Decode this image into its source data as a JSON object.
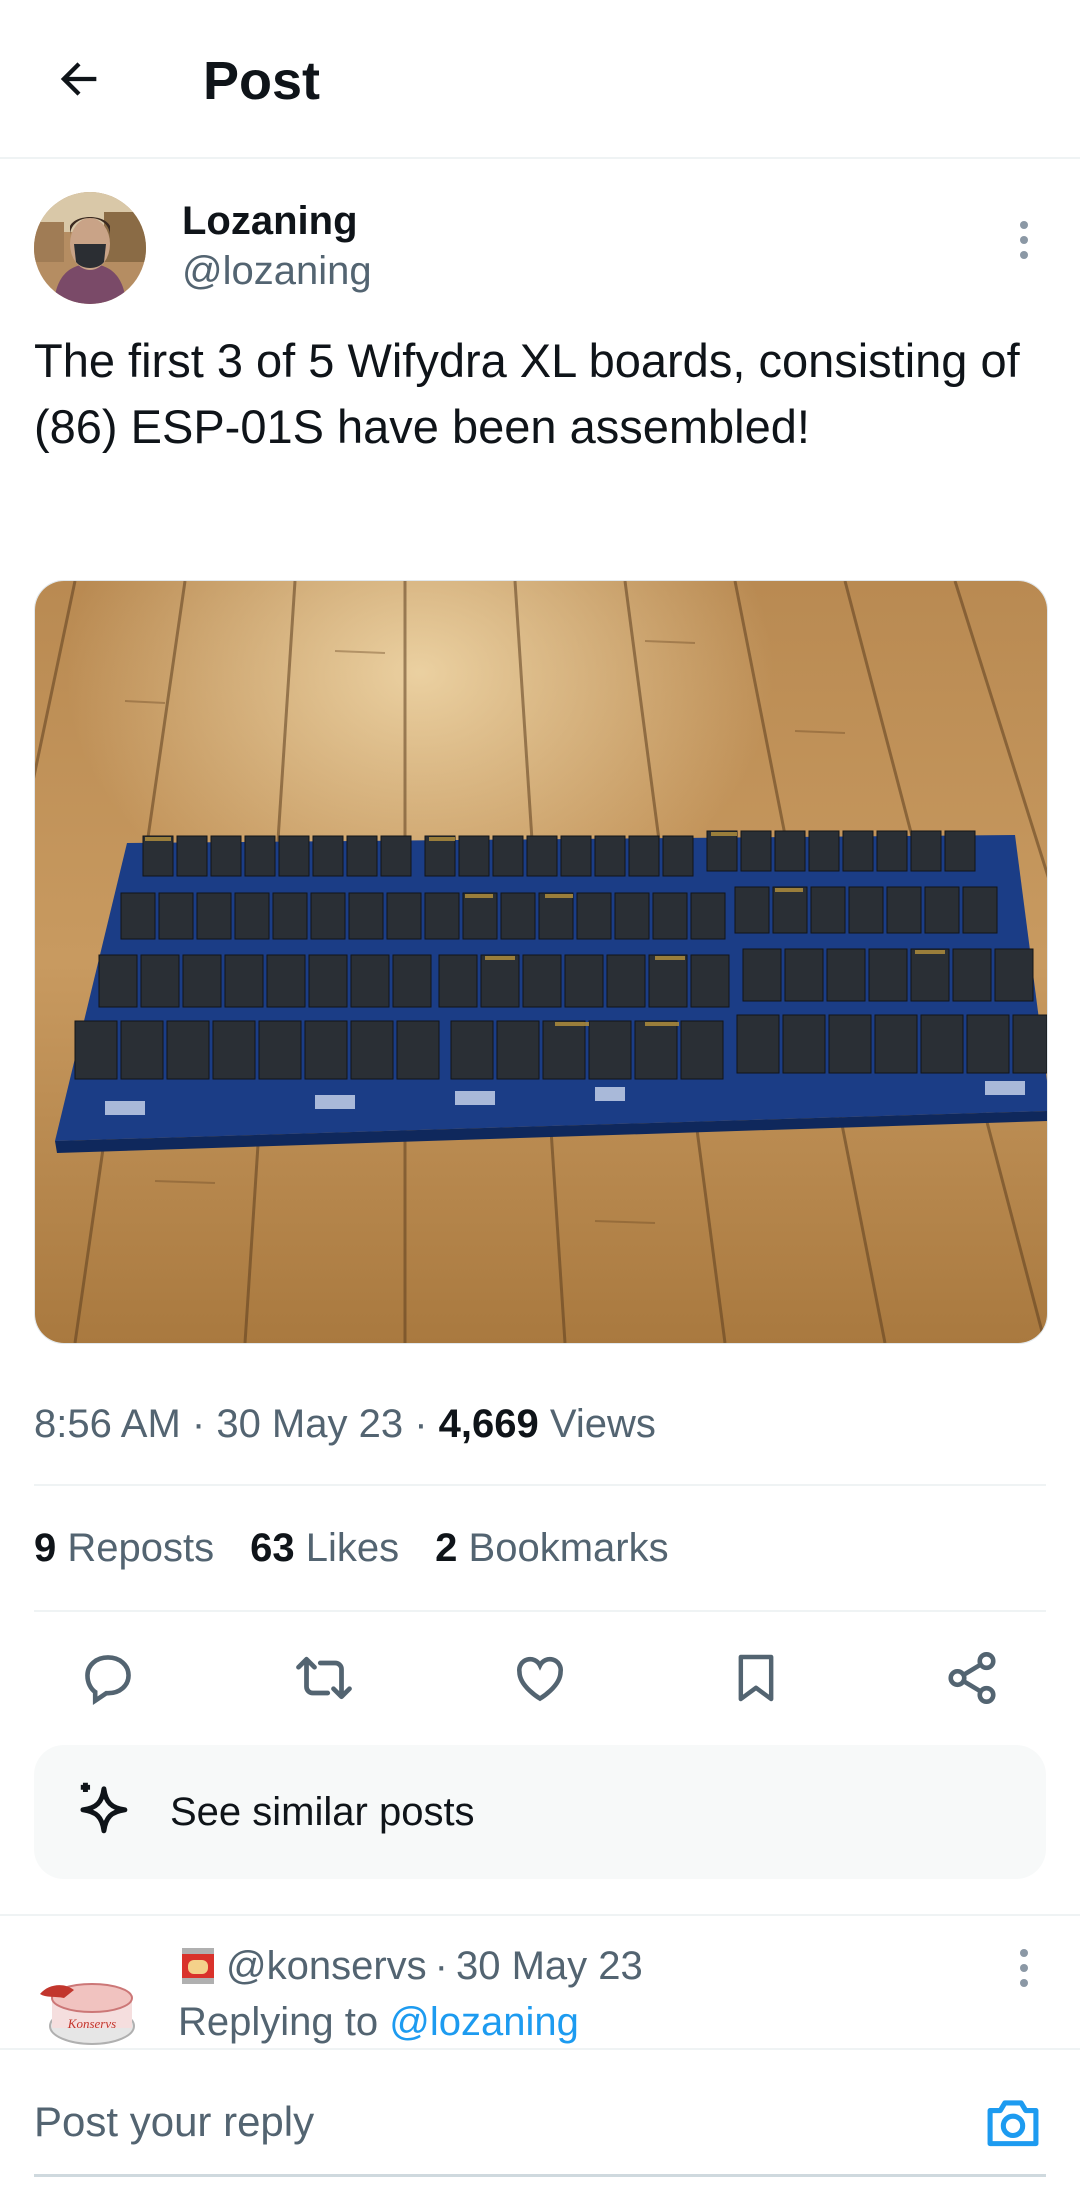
{
  "header": {
    "title": "Post"
  },
  "post": {
    "author_name": "Lozaning",
    "author_handle": "@lozaning",
    "text": "The first 3 of 5 Wifydra XL boards, consisting of (86) ESP-01S have been assembled!",
    "time": "8:56 AM",
    "date": "30 May 23",
    "views_count": "4,669",
    "views_label": "Views",
    "reposts_count": "9",
    "reposts_label": "Reposts",
    "likes_count": "63",
    "likes_label": "Likes",
    "bookmarks_count": "2",
    "bookmarks_label": "Bookmarks"
  },
  "similar": {
    "label": "See similar posts"
  },
  "reply": {
    "handle": "@konservs",
    "date": "30 May 23",
    "replying_prefix": "Replying to ",
    "replying_to": "@lozaning",
    "avatar_text": "Konservs"
  },
  "composer": {
    "placeholder": "Post your reply"
  },
  "colors": {
    "accent": "#1d9bf0",
    "text": "#0f1419",
    "secondary": "#536471",
    "divider": "#eff3f4"
  },
  "icons": [
    "back-arrow-icon",
    "more-icon",
    "reply-icon",
    "repost-icon",
    "like-icon",
    "bookmark-icon",
    "share-icon",
    "sparkle-icon",
    "can-icon",
    "camera-icon"
  ]
}
